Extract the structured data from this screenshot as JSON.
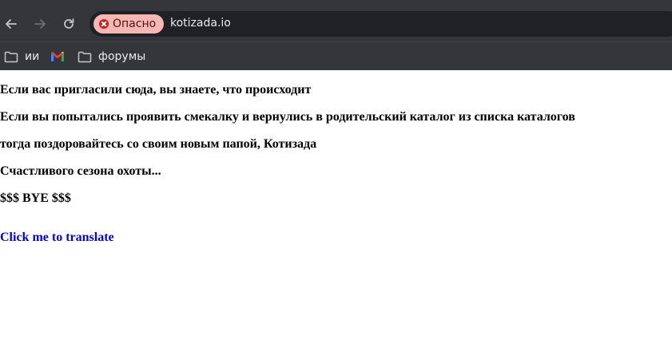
{
  "browser": {
    "security_label": "Опасно",
    "url": "kotizada.io",
    "bookmarks": [
      {
        "label": "ии",
        "icon": "folder-icon"
      },
      {
        "label": "",
        "icon": "gmail-icon"
      },
      {
        "label": "форумы",
        "icon": "folder-icon"
      }
    ],
    "colors": {
      "security_chip_bg": "#f7b7b3",
      "security_icon": "#c5221f"
    }
  },
  "page": {
    "lines": [
      "Если вас пригласили сюда, вы знаете, что происходит",
      "Если вы попытались проявить смекалку и вернулись в родительский каталог из списка каталогов",
      "тогда поздоровайтесь со своим новым папой, Котизада",
      "Счастливого сезона охоты...",
      "$$$ BYE $$$"
    ],
    "translate_link": "Click me to translate",
    "link_color": "#0000ee"
  }
}
